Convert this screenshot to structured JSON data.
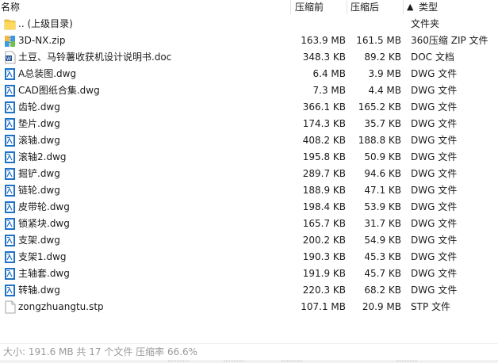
{
  "header": {
    "name": "名称",
    "packed": "压缩前",
    "unpacked": "压缩后",
    "sort_arrow": "▲",
    "type": "类型"
  },
  "rows": [
    {
      "name": ".. (上级目录)",
      "packed": "",
      "unpacked": "",
      "type": "文件夹",
      "icon": "folder-icon"
    },
    {
      "name": "3D-NX.zip",
      "packed": "163.9 MB",
      "unpacked": "161.5 MB",
      "type": "360压缩 ZIP 文件",
      "icon": "zip-icon"
    },
    {
      "name": "土豆、马铃薯收获机设计说明书.doc",
      "packed": "348.3 KB",
      "unpacked": "89.2 KB",
      "type": "DOC 文档",
      "icon": "word-doc-icon"
    },
    {
      "name": "A总装图.dwg",
      "packed": "6.4 MB",
      "unpacked": "3.9 MB",
      "type": "DWG 文件",
      "icon": "dwg-icon"
    },
    {
      "name": "CAD图纸合集.dwg",
      "packed": "7.3 MB",
      "unpacked": "4.4 MB",
      "type": "DWG 文件",
      "icon": "dwg-icon"
    },
    {
      "name": "齿轮.dwg",
      "packed": "366.1 KB",
      "unpacked": "165.2 KB",
      "type": "DWG 文件",
      "icon": "dwg-icon"
    },
    {
      "name": "垫片.dwg",
      "packed": "174.3 KB",
      "unpacked": "35.7 KB",
      "type": "DWG 文件",
      "icon": "dwg-icon"
    },
    {
      "name": "滚轴.dwg",
      "packed": "408.2 KB",
      "unpacked": "188.8 KB",
      "type": "DWG 文件",
      "icon": "dwg-icon"
    },
    {
      "name": "滚轴2.dwg",
      "packed": "195.8 KB",
      "unpacked": "50.9 KB",
      "type": "DWG 文件",
      "icon": "dwg-icon"
    },
    {
      "name": "掘铲.dwg",
      "packed": "289.7 KB",
      "unpacked": "94.6 KB",
      "type": "DWG 文件",
      "icon": "dwg-icon"
    },
    {
      "name": "链轮.dwg",
      "packed": "188.9 KB",
      "unpacked": "47.1 KB",
      "type": "DWG 文件",
      "icon": "dwg-icon"
    },
    {
      "name": "皮带轮.dwg",
      "packed": "198.4 KB",
      "unpacked": "53.9 KB",
      "type": "DWG 文件",
      "icon": "dwg-icon"
    },
    {
      "name": "锁紧块.dwg",
      "packed": "165.7 KB",
      "unpacked": "31.7 KB",
      "type": "DWG 文件",
      "icon": "dwg-icon"
    },
    {
      "name": "支架.dwg",
      "packed": "200.2 KB",
      "unpacked": "54.9 KB",
      "type": "DWG 文件",
      "icon": "dwg-icon"
    },
    {
      "name": "支架1.dwg",
      "packed": "190.3 KB",
      "unpacked": "45.3 KB",
      "type": "DWG 文件",
      "icon": "dwg-icon"
    },
    {
      "name": "主轴套.dwg",
      "packed": "191.9 KB",
      "unpacked": "45.7 KB",
      "type": "DWG 文件",
      "icon": "dwg-icon"
    },
    {
      "name": "转轴.dwg",
      "packed": "220.3 KB",
      "unpacked": "68.2 KB",
      "type": "DWG 文件",
      "icon": "dwg-icon"
    },
    {
      "name": "zongzhuangtu.stp",
      "packed": "107.1 MB",
      "unpacked": "20.9 MB",
      "type": "STP 文件",
      "icon": "stp-file-icon"
    }
  ],
  "status": {
    "text": "大小: 191.6 MB 共 17 个文件 压缩率 66.6%"
  },
  "colors": {
    "folder": "#f5c842",
    "dwg_blue": "#1e73c8",
    "word_blue": "#2b5797",
    "status_gray": "#9a9a9a"
  }
}
